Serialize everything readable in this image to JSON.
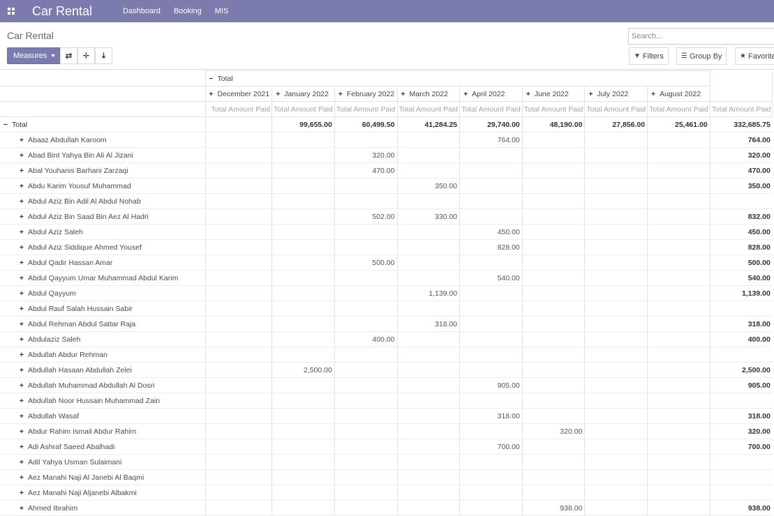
{
  "app": {
    "title": "Car Rental"
  },
  "nav": {
    "items": [
      "Dashboard",
      "Booking",
      "MIS"
    ]
  },
  "breadcrumb": "Car Rental",
  "toolbar": {
    "measures_label": "Measures",
    "search_placeholder": "Search...",
    "filters_label": "Filters",
    "groupby_label": "Group By",
    "favorites_label": "Favorites"
  },
  "pivot": {
    "header_total": "Total",
    "columns": [
      "December 2021",
      "January 2022",
      "February 2022",
      "March 2022",
      "April 2022",
      "June 2022",
      "July 2022",
      "August 2022"
    ],
    "measure": "Total Amount Paid",
    "total_row": {
      "label": "Total",
      "values": [
        "",
        "99,655.00",
        "60,499.50",
        "41,284.25",
        "29,740.00",
        "48,190.00",
        "27,856.00",
        "25,461.00",
        "332,685.75"
      ]
    },
    "rows": [
      {
        "label": "Abaaz Abdullah Karoom",
        "values": [
          "",
          "",
          "",
          "",
          "764.00",
          "",
          "",
          "",
          "764.00"
        ]
      },
      {
        "label": "Abad Bint Yahya Bin Ali Al Jizani",
        "values": [
          "",
          "",
          "320.00",
          "",
          "",
          "",
          "",
          "",
          "320.00"
        ]
      },
      {
        "label": "Abal Youhanis Barhani Zarzaqi",
        "values": [
          "",
          "",
          "470.00",
          "",
          "",
          "",
          "",
          "",
          "470.00"
        ]
      },
      {
        "label": "Abdu Karim Yousuf Muhammad",
        "values": [
          "",
          "",
          "",
          "350.00",
          "",
          "",
          "",
          "",
          "350.00"
        ]
      },
      {
        "label": "Abdul Aziz Bin Adil Al Abdul Nohab",
        "values": [
          "",
          "",
          "",
          "",
          "",
          "",
          "",
          "",
          ""
        ]
      },
      {
        "label": "Abdul Aziz Bin Saad Bin Aez Al Hadri",
        "values": [
          "",
          "",
          "502.00",
          "330.00",
          "",
          "",
          "",
          "",
          "832.00"
        ]
      },
      {
        "label": "Abdul Aziz Saleh",
        "values": [
          "",
          "",
          "",
          "",
          "450.00",
          "",
          "",
          "",
          "450.00"
        ]
      },
      {
        "label": "Abdul Aziz Siddique Ahmed Yousef",
        "values": [
          "",
          "",
          "",
          "",
          "828.00",
          "",
          "",
          "",
          "828.00"
        ]
      },
      {
        "label": "Abdul Qadir Hassan Amar",
        "values": [
          "",
          "",
          "500.00",
          "",
          "",
          "",
          "",
          "",
          "500.00"
        ]
      },
      {
        "label": "Abdul Qayyum Umar Muhammad Abdul Karim",
        "values": [
          "",
          "",
          "",
          "",
          "540.00",
          "",
          "",
          "",
          "540.00"
        ]
      },
      {
        "label": "Abdul Qayyum",
        "values": [
          "",
          "",
          "",
          "1,139.00",
          "",
          "",
          "",
          "",
          "1,139.00"
        ]
      },
      {
        "label": "Abdul Rauf Salah Hussain Sabir",
        "values": [
          "",
          "",
          "",
          "",
          "",
          "",
          "",
          "",
          ""
        ]
      },
      {
        "label": "Abdul Rehman Abdul Sattar Raja",
        "values": [
          "",
          "",
          "",
          "318.00",
          "",
          "",
          "",
          "",
          "318.00"
        ]
      },
      {
        "label": "Abdulaziz Saleh",
        "values": [
          "",
          "",
          "400.00",
          "",
          "",
          "",
          "",
          "",
          "400.00"
        ]
      },
      {
        "label": "Abdullah Abdur Rehman",
        "values": [
          "",
          "",
          "",
          "",
          "",
          "",
          "",
          "",
          ""
        ]
      },
      {
        "label": "Abdullah Hasaan Abdullah Zelei",
        "values": [
          "",
          "2,500.00",
          "",
          "",
          "",
          "",
          "",
          "",
          "2,500.00"
        ]
      },
      {
        "label": "Abdullah Muhammad Abdullah Al Dosri",
        "values": [
          "",
          "",
          "",
          "",
          "905.00",
          "",
          "",
          "",
          "905.00"
        ]
      },
      {
        "label": "Abdullah Noor Hussain Muhammad Zain",
        "values": [
          "",
          "",
          "",
          "",
          "",
          "",
          "",
          "",
          ""
        ]
      },
      {
        "label": "Abdullah Wasaf",
        "values": [
          "",
          "",
          "",
          "",
          "318.00",
          "",
          "",
          "",
          "318.00"
        ]
      },
      {
        "label": "Abdur Rahim Ismail Abdur Rahim",
        "values": [
          "",
          "",
          "",
          "",
          "",
          "320.00",
          "",
          "",
          "320.00"
        ]
      },
      {
        "label": "Adi Ashraf Saeed Abalhadi",
        "values": [
          "",
          "",
          "",
          "",
          "700.00",
          "",
          "",
          "",
          "700.00"
        ]
      },
      {
        "label": "Adil Yahya Usman Sulaimani",
        "values": [
          "",
          "",
          "",
          "",
          "",
          "",
          "",
          "",
          ""
        ]
      },
      {
        "label": "Aez Manahi Naji Al Janebi Al Baqmi",
        "values": [
          "",
          "",
          "",
          "",
          "",
          "",
          "",
          "",
          ""
        ]
      },
      {
        "label": "Aez Manahi Naji Aljanebi Albakmi",
        "values": [
          "",
          "",
          "",
          "",
          "",
          "",
          "",
          "",
          ""
        ]
      },
      {
        "label": "Ahmed Ibrahim",
        "values": [
          "",
          "",
          "",
          "",
          "",
          "938.00",
          "",
          "",
          "938.00"
        ]
      }
    ]
  },
  "colors": {
    "navbar": "#7c7bad",
    "primary_button": "#7c7bad"
  },
  "icons": [
    "apps-icon",
    "flip-axis-icon",
    "expand-all-icon",
    "download-icon",
    "filter-icon",
    "group-by-icon",
    "star-icon",
    "plus-icon",
    "minus-icon"
  ]
}
